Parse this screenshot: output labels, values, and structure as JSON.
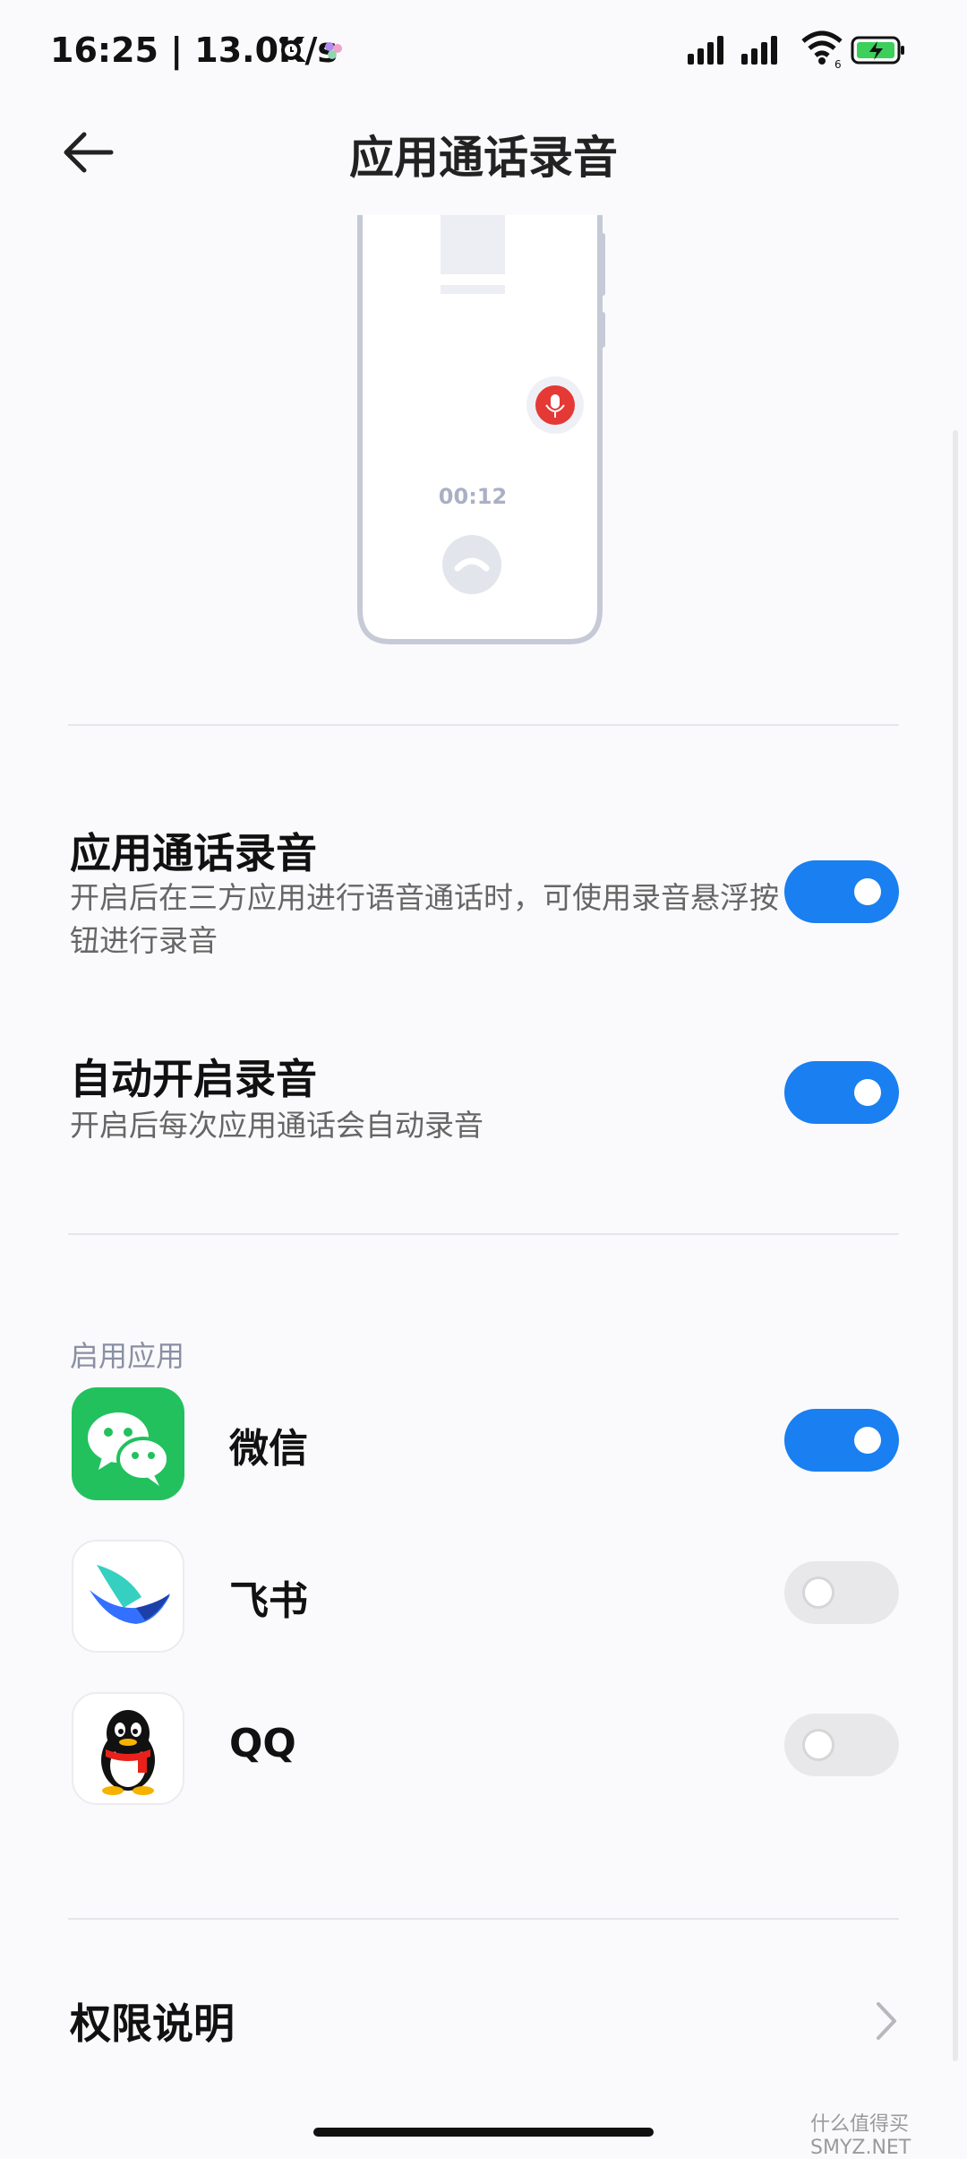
{
  "status_bar": {
    "time_speed": "16:25 | 13.0K/s"
  },
  "header": {
    "title": "应用通话录音"
  },
  "illustration": {
    "timer": "00:12"
  },
  "settings": {
    "app_call_recording": {
      "title": "应用通话录音",
      "desc": "开启后在三方应用进行语音通话时，可使用录音悬浮按钮进行录音",
      "enabled": true
    },
    "auto_record": {
      "title": "自动开启录音",
      "desc": "开启后每次应用通话会自动录音",
      "enabled": true
    }
  },
  "apps_section": {
    "label": "启用应用",
    "apps": [
      {
        "name": "微信",
        "icon": "wechat-icon",
        "enabled": true
      },
      {
        "name": "飞书",
        "icon": "feishu-icon",
        "enabled": false
      },
      {
        "name": "QQ",
        "icon": "qq-icon",
        "enabled": false
      }
    ]
  },
  "permissions": {
    "label": "权限说明"
  },
  "colors": {
    "accent": "#1a7ff0",
    "toggle_off": "#e8e8ea",
    "record_red": "#e53935",
    "wechat_green": "#22c15e"
  },
  "watermark": "什么值得买 SMYZ.NET"
}
